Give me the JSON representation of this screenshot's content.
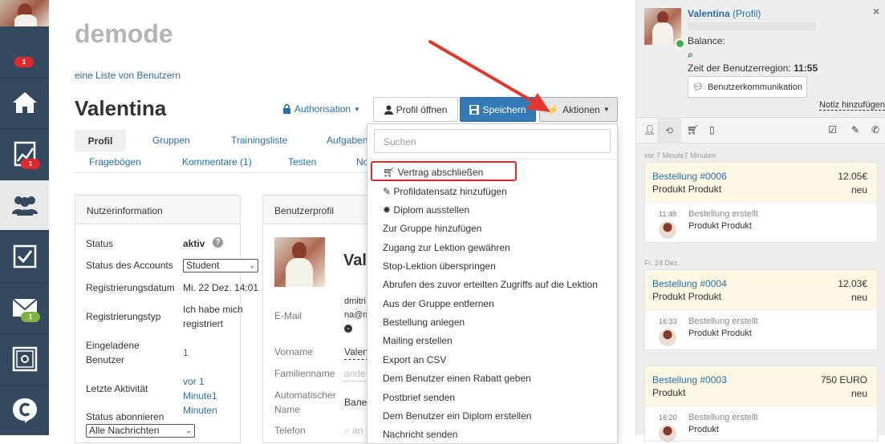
{
  "sidebar": {
    "badges": [
      "1",
      "1",
      "1"
    ]
  },
  "main": {
    "app_title": "demode",
    "users_link": "eine Liste von Benutzern",
    "user_name": "Valentina",
    "authorisation_label": "Authorisation",
    "open_profile_label": "Profil öffnen",
    "save_label": "Speichern",
    "actions_label": "Aktionen",
    "tabs_row1": [
      "Profil",
      "Gruppen",
      "Trainingsliste",
      "Aufgaben"
    ],
    "tabs_row2": [
      "Fragebögen",
      "Kommentare (1)",
      "Testen",
      "No"
    ],
    "info_panel": {
      "title": "Nutzerinformation",
      "rows": [
        {
          "label": "Status",
          "value": "aktiv"
        },
        {
          "label": "Status des Accounts",
          "value": "Student"
        },
        {
          "label": "Registrierungsdatum",
          "value": "Mi. 22 Dez. 14:01"
        },
        {
          "label": "Registrierungstyp",
          "value": "Ich habe mich registriert"
        },
        {
          "label": "Eingeladene Benutzer",
          "value": "1"
        },
        {
          "label": "Letzte Aktivität",
          "value": "vor 1 Minute1 Minuten"
        },
        {
          "label": "Status abonnieren",
          "value": "Alle Nachrichten"
        }
      ]
    },
    "profile_panel": {
      "title": "Benutzerprofil",
      "name_partial": "Vale",
      "labels": [
        "E-Mail",
        "Vorname",
        "Familienname",
        "Automatischer Name",
        "Telefon"
      ],
      "email_partial1": "dmitri",
      "email_partial2": "na@m",
      "firstname_partial": "Valen",
      "lastname_placeholder": "ande",
      "autoname_partial": "Вале",
      "phone_partial": "an"
    }
  },
  "dropdown": {
    "search_placeholder": "Suchen",
    "items": [
      "Vertrag abschließen",
      "Profildatensatz hinzufügen",
      "Diplom ausstellen",
      "Zur Gruppe hinzufügen",
      "Zugang zur Lektion gewähren",
      "Stop-Lektion überspringen",
      "Abrufen des zuvor erteilten Zugriffs auf die Lektion",
      "Aus der Gruppe entfernen",
      "Bestellung anlegen",
      "Mailing erstellen",
      "Export an CSV",
      "Dem Benutzer einen Rabatt geben",
      "Postbrief senden",
      "Dem Benutzer ein Diplom erstellen",
      "Nachricht senden"
    ]
  },
  "right": {
    "name": "Valentina",
    "profile_link": "(Profil)",
    "balance_label": "Balance:",
    "region_label": "Zeit der Benutzerregion:",
    "region_time": "11:55",
    "comm_button": "Benutzerkommunikation",
    "note_link": "Notiz hinzufügen",
    "timeline": [
      {
        "date": "vor 7 Minute7 Minuten",
        "order": "Bestellung #0006",
        "amount": "12.05€",
        "product": "Produkt Produkt",
        "status": "neu",
        "time": "11:48",
        "event": "Bestellung erstellt",
        "event_product": "Produkt Produkt"
      },
      {
        "date": "Fr. 24 Dez.",
        "order": "Bestellung #0004",
        "amount": "12.03€",
        "product": "Produkt Produkt",
        "status": "neu",
        "time": "16:33",
        "event": "Bestellung erstellt",
        "event_product": "Produkt Produkt"
      },
      {
        "date": "",
        "order": "Bestellung #0003",
        "amount": "750 EURO",
        "product": "Produkt",
        "status": "neu",
        "time": "16:20",
        "event": "Bestellung erstellt",
        "event_product": "Produkt"
      }
    ]
  },
  "colors": {
    "primary": "#337ab7",
    "sidebar": "#34495e",
    "highlight": "#e0292c",
    "annotation_arrow": "#e0392b"
  }
}
